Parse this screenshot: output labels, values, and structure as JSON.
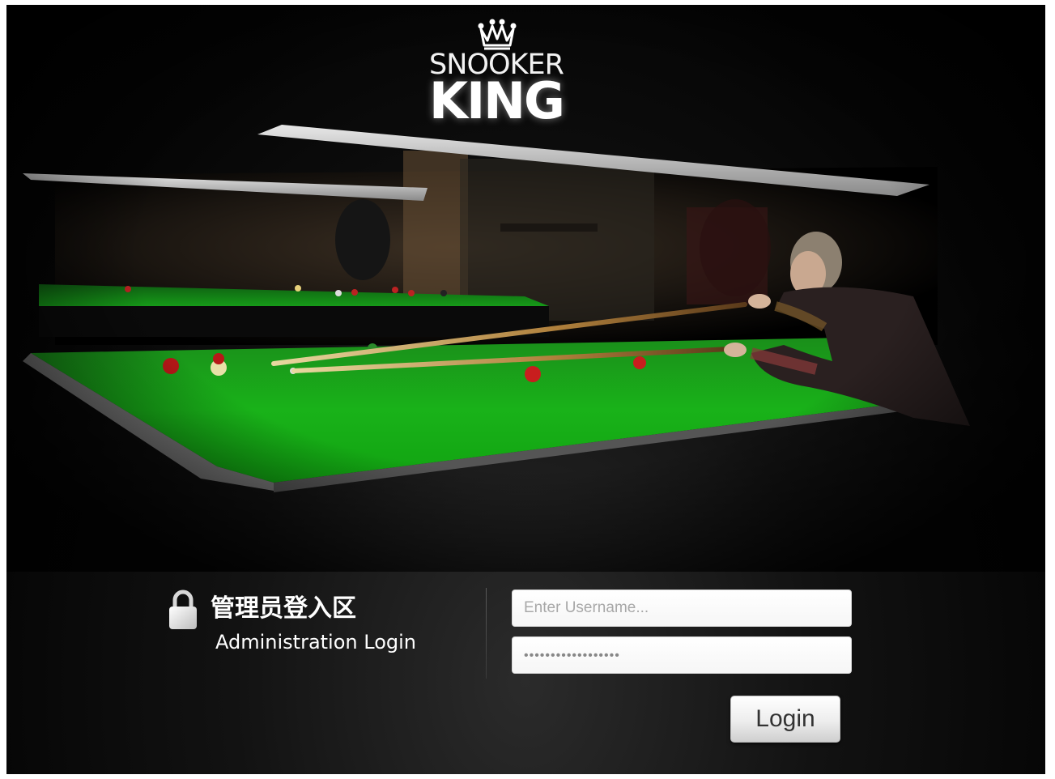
{
  "brand": {
    "name_top": "SNOOKER",
    "name_bottom": "KING",
    "logo_icon": "crown-icon"
  },
  "login": {
    "heading_cn": "管理员登入区",
    "heading_en": "Administration Login",
    "lock_icon": "lock-icon",
    "username_placeholder": "Enter Username...",
    "password_placeholder": "••••••••••••••••••",
    "button_label": "Login"
  },
  "colors": {
    "background": "#000000",
    "table_felt": "#18a818",
    "text": "#ffffff"
  }
}
